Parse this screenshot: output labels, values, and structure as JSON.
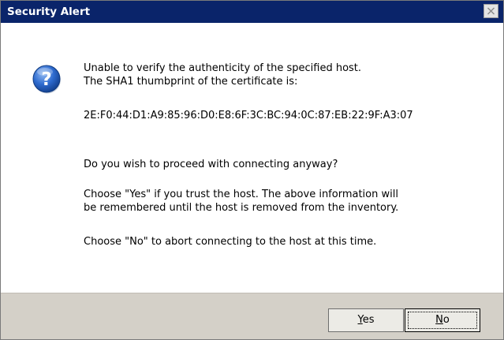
{
  "window": {
    "title": "Security Alert",
    "close_icon": "close-icon"
  },
  "message": {
    "icon": "question-icon",
    "line1": "Unable to verify the authenticity of the specified host.",
    "line2": "The SHA1 thumbprint of the certificate is:",
    "thumbprint": "2E:F0:44:D1:A9:85:96:D0:E8:6F:3C:BC:94:0C:87:EB:22:9F:A3:07",
    "question": "Do you wish to proceed with connecting anyway?",
    "yes_line1": "Choose \"Yes\" if you trust the host. The above information will",
    "yes_line2": "be remembered until the host is removed from the inventory.",
    "no_line": "Choose \"No\" to abort connecting to the host at this time."
  },
  "buttons": {
    "yes_accel": "Y",
    "yes_rest": "es",
    "no_accel": "N",
    "no_rest": "o"
  },
  "colors": {
    "titlebar": "#0a246a",
    "footer": "#d4d0c8",
    "icon_blue": "#1f5bbd"
  }
}
